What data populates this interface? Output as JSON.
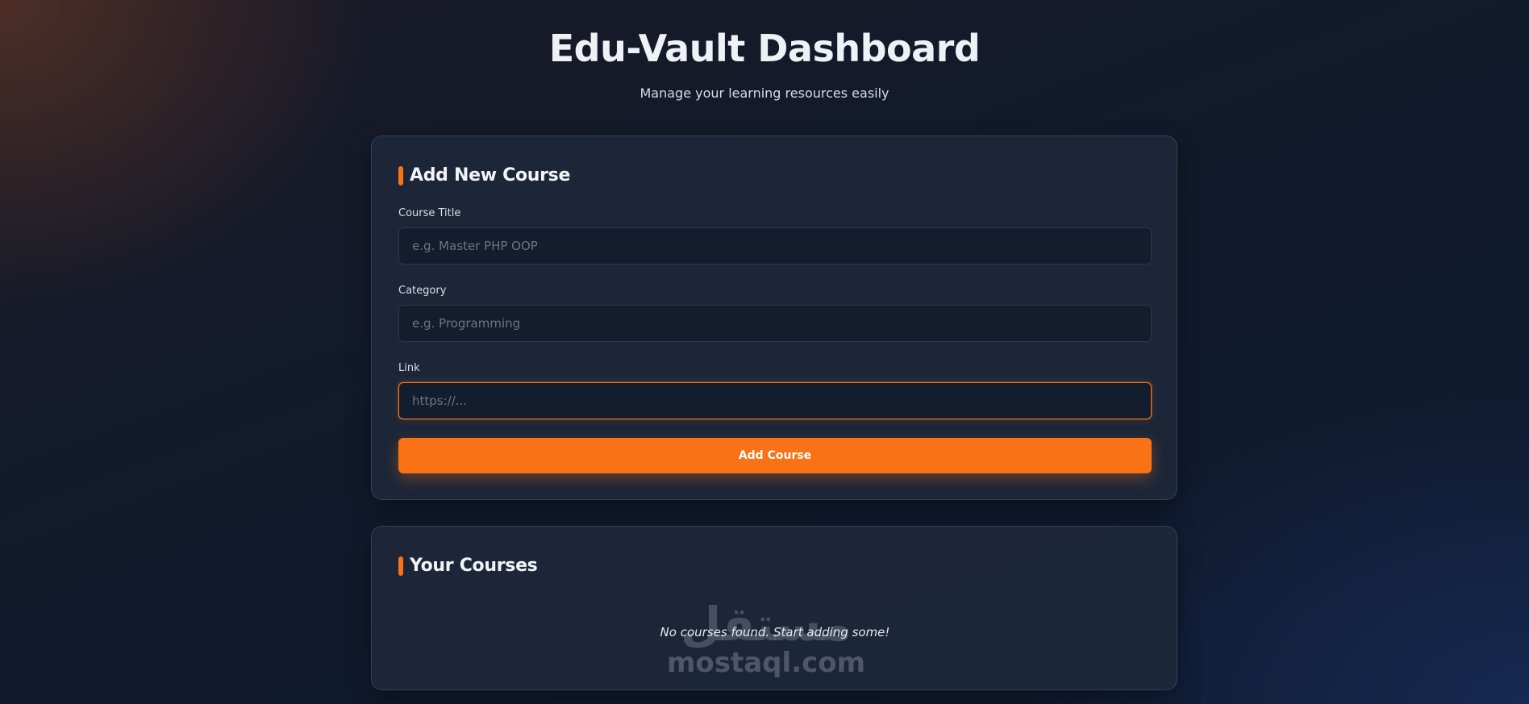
{
  "header": {
    "title": "Edu-Vault Dashboard",
    "subtitle": "Manage your learning resources easily"
  },
  "add_course": {
    "heading": "Add New Course",
    "fields": [
      {
        "label": "Course Title",
        "placeholder": "e.g. Master PHP OOP",
        "value": ""
      },
      {
        "label": "Category",
        "placeholder": "e.g. Programming",
        "value": ""
      },
      {
        "label": "Link",
        "placeholder": "https://...",
        "value": "",
        "focused": true
      }
    ],
    "submit_label": "Add Course"
  },
  "courses": {
    "heading": "Your Courses",
    "empty_message": "No courses found. Start adding some!"
  },
  "watermark": {
    "arabic": "مستقل",
    "latin": "mostaql.com"
  },
  "colors": {
    "accent": "#f97316",
    "card_bg": "#1e293b",
    "input_bg": "#141d2e"
  }
}
